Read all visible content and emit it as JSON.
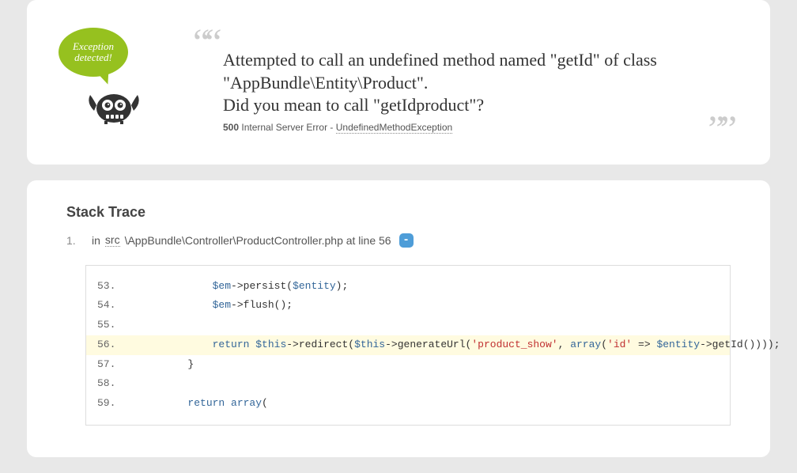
{
  "speech": "Exception detected!",
  "error": {
    "message1": "Attempted to call an undefined method named \"getId\" of class \"AppBundle\\Entity\\Product\".",
    "message2": "Did you mean to call \"getIdproduct\"?",
    "code": "500",
    "codeText": "Internal Server Error - ",
    "exception": "UndefinedMethodException"
  },
  "trace": {
    "title": "Stack Trace",
    "num": "1.",
    "in": "in ",
    "src": "src",
    "path": "\\AppBundle\\Controller\\ProductController.php at line 56",
    "toggle": "-"
  },
  "code": {
    "l53": {
      "n": "53.",
      "indent": "            ",
      "v1": "$em",
      "op1": "->",
      "f1": "persist",
      "p1": "(",
      "v2": "$entity",
      "p2": ");"
    },
    "l54": {
      "n": "54.",
      "indent": "            ",
      "v1": "$em",
      "op1": "->",
      "f1": "flush",
      "p1": "();"
    },
    "l55": {
      "n": "55."
    },
    "l56": {
      "n": "56.",
      "indent": "            ",
      "kw": "return ",
      "v1": "$this",
      "op1": "->",
      "f1": "redirect",
      "p1": "(",
      "v2": "$this",
      "op2": "->",
      "f2": "generateUrl",
      "p2": "(",
      "s1": "'product_show'",
      "c1": ", ",
      "kw2": "array",
      "p3": "(",
      "s2": "'id'",
      "c2": " => ",
      "v3": "$entity",
      "op3": "->",
      "f3": "getId",
      "p4": "())));"
    },
    "l57": {
      "n": "57.",
      "indent": "        ",
      "t": "}"
    },
    "l58": {
      "n": "58."
    },
    "l59": {
      "n": "59.",
      "indent": "        ",
      "kw": "return ",
      "kw2": "array",
      "p": "("
    }
  }
}
